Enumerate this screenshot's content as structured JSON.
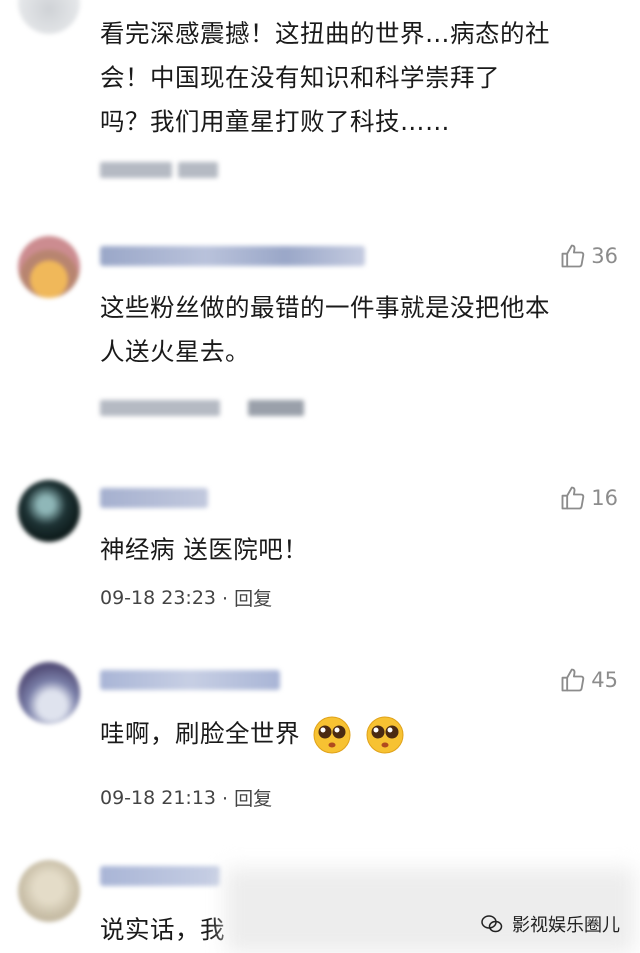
{
  "comments": [
    {
      "text_lines": [
        "看完深感震撼！这扭曲的世界…病态的社",
        "会！中国现在没有知识和科学崇拜了",
        "吗？我们用童星打败了科技……"
      ]
    },
    {
      "likes": "36",
      "text_lines": [
        "这些粉丝做的最错的一件事就是没把他本",
        "人送火星去。"
      ]
    },
    {
      "name": "Jolin 天王",
      "likes": "16",
      "text_lines": [
        "神经病  送医院吧！"
      ],
      "time": "09-18 23:23",
      "reply": "· 回复"
    },
    {
      "likes": "45",
      "text_lines": [
        "哇啊，刷脸全世界"
      ],
      "emoji": "pleading-face-emoji",
      "time": "09-18 21:13",
      "reply": "· 回复"
    },
    {
      "text_lines": [
        "说实话，我"
      ]
    }
  ],
  "watermark": {
    "label": "影视娱乐圈儿",
    "icon": "wechat-icon"
  },
  "colors": {
    "text": "#1a1a1a",
    "meta": "#444444",
    "like": "#8c8c8c"
  }
}
